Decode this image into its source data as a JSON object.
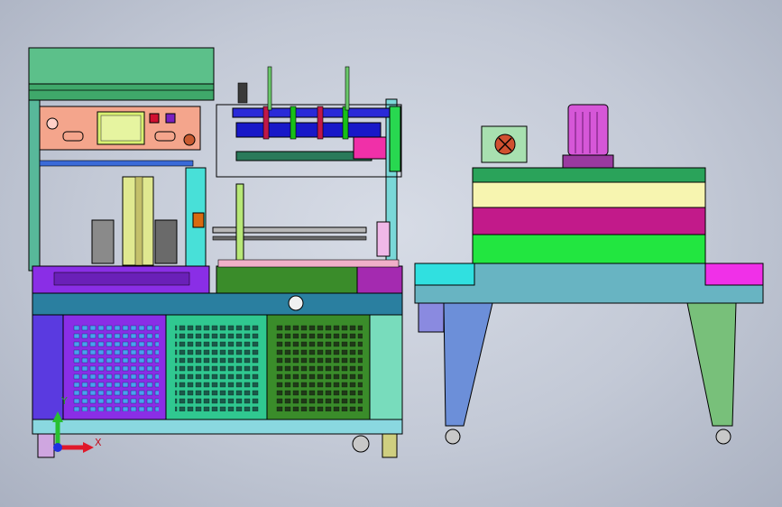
{
  "viewport": {
    "background": "#c8cdd8"
  },
  "triad": {
    "x_label": "X",
    "y_label": "Y",
    "x_color": "#e0182a",
    "y_color": "#28c030",
    "origin_color": "#2030e0"
  },
  "machine_left": {
    "name": "l-type-sealer",
    "hood_color": "#5cc08a",
    "panel_color": "#f4a58c",
    "screen_color": "#d8f070",
    "door_colors": [
      "#8a2ee6",
      "#30c890",
      "#3a8c2a"
    ],
    "base_color": "#2a7fa0"
  },
  "machine_right": {
    "name": "shrink-tunnel",
    "bands": [
      "#2aa35a",
      "#f7f5b0",
      "#c21a8a",
      "#22e640"
    ],
    "motor_color": "#d657d8",
    "table_color": "#68b4c2",
    "leg_left_color": "#6c8fd9",
    "leg_right_color": "#78c07a"
  }
}
